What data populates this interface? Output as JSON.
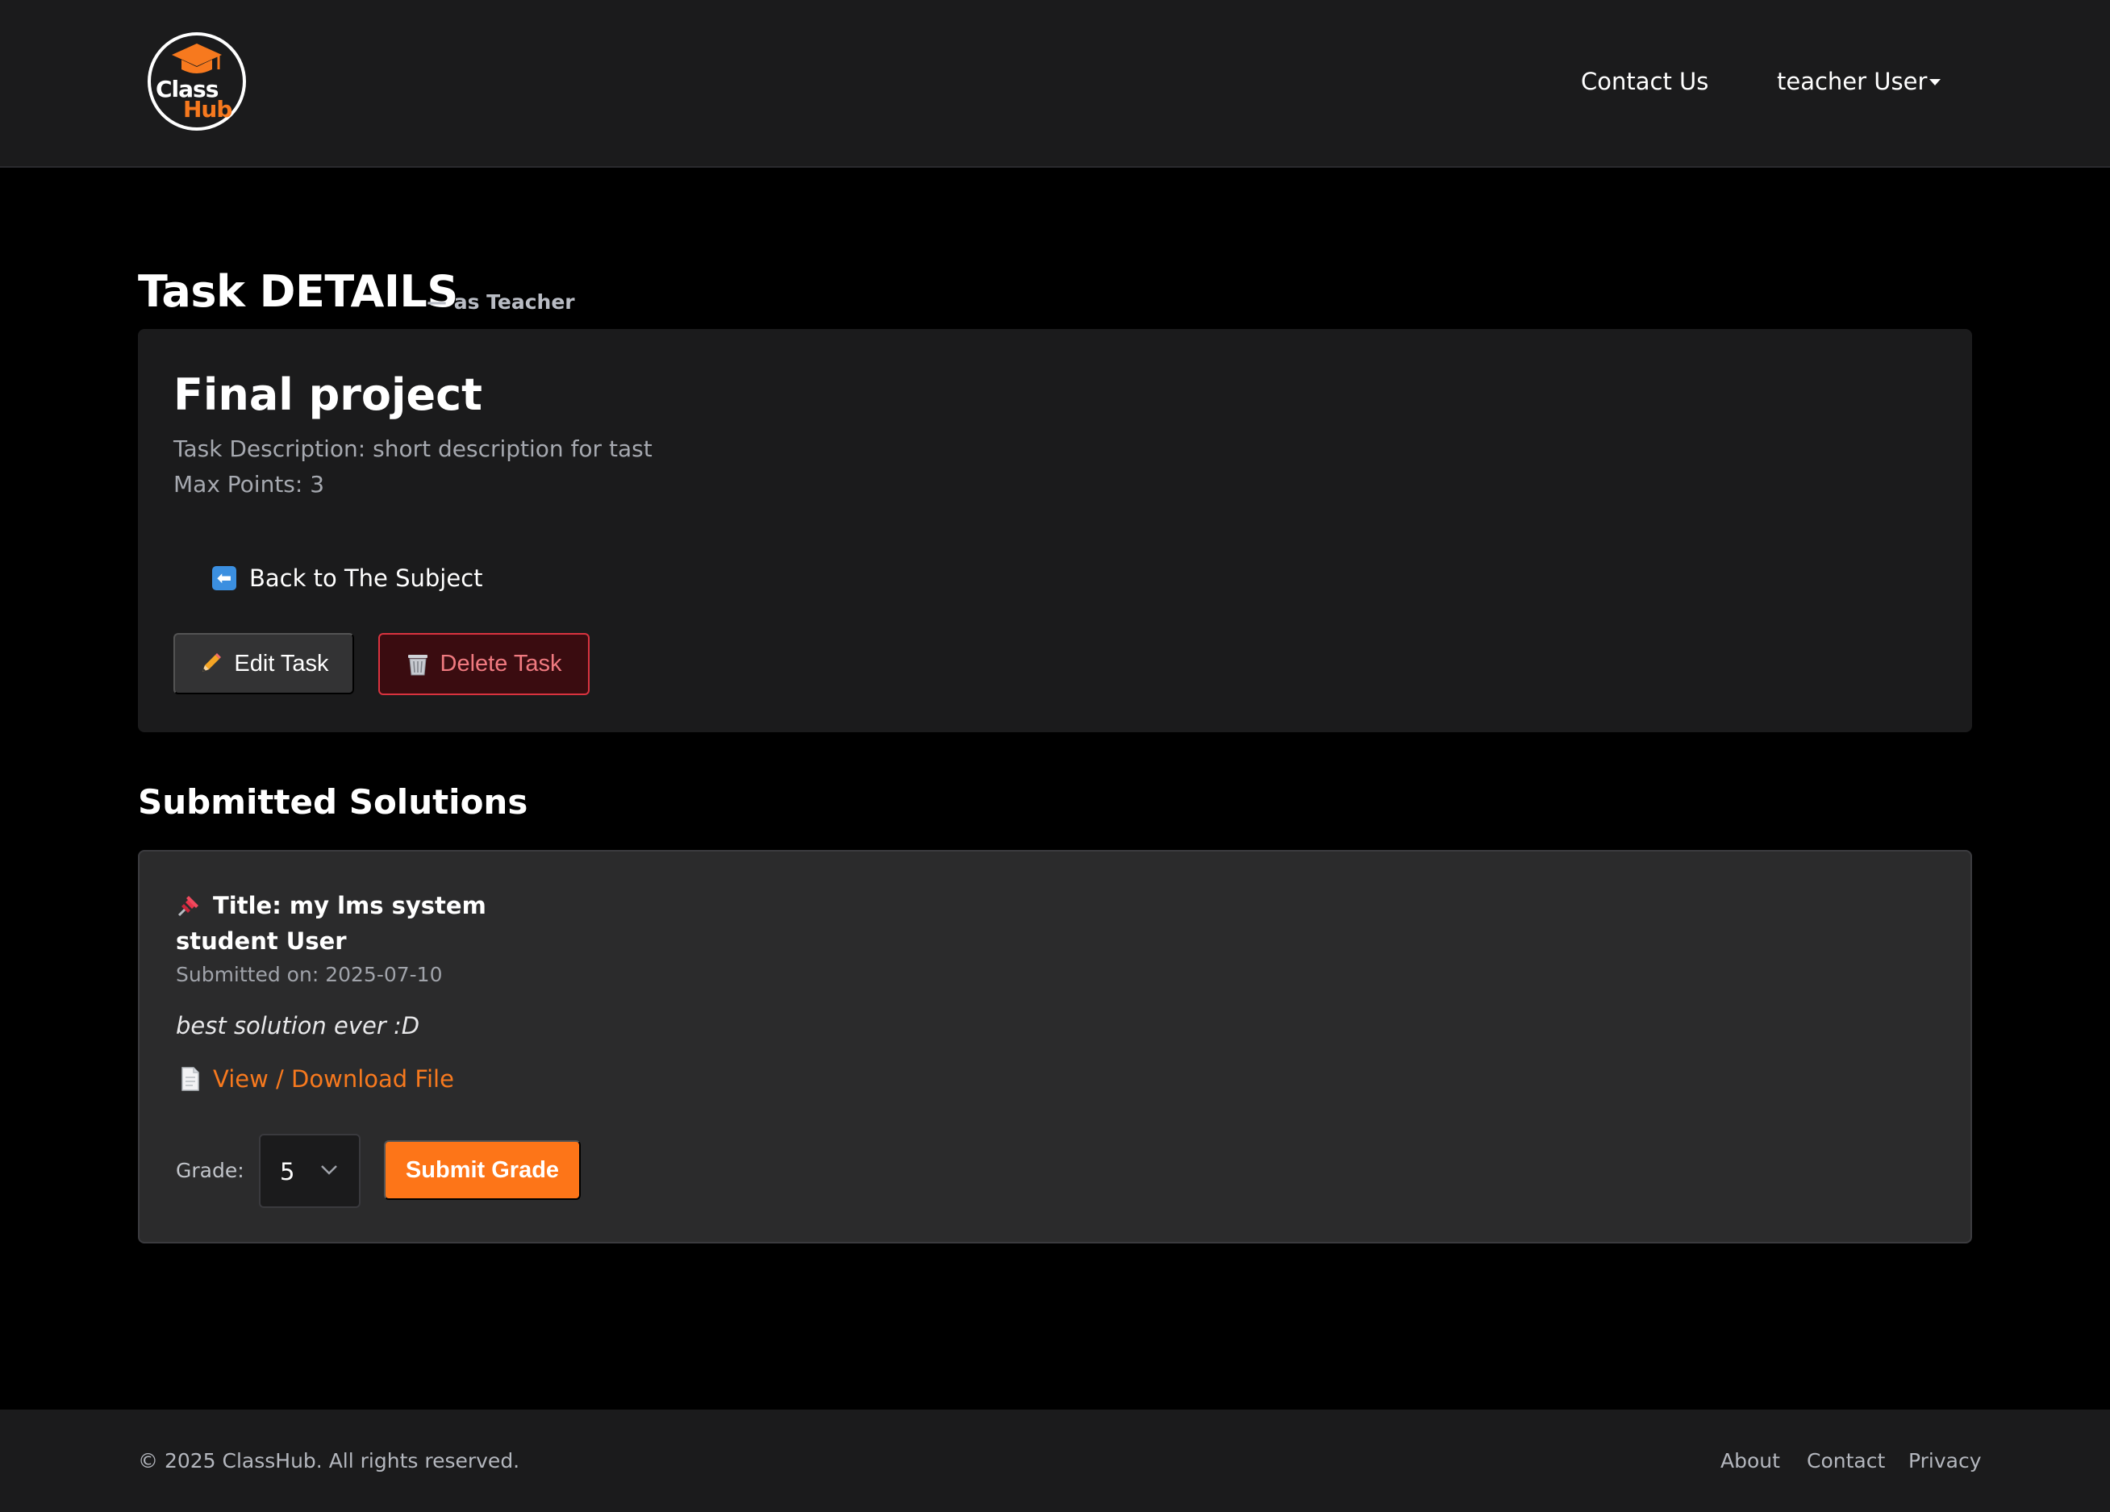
{
  "navbar": {
    "logo_text_1": "Class",
    "logo_text_2": "Hub",
    "contact_label": "Contact Us",
    "user_label": "teacher User"
  },
  "page": {
    "heading": "Task DETAILS",
    "heading_sub": "— as Teacher"
  },
  "task": {
    "title": "Final project",
    "description": "Task Description: short description for tast",
    "max_points": "Max Points: 3",
    "back_label": "Back to The Subject",
    "edit_label": "Edit Task",
    "delete_label": "Delete Task"
  },
  "submissions": {
    "section_title": "Submitted Solutions",
    "items": [
      {
        "title": "Title: my lms system",
        "student": "student User",
        "submitted_on": "Submitted on: 2025-07-10",
        "comment": "best solution ever :D",
        "file_label": "View / Download File",
        "grade_label": "Grade:",
        "grade_value": "5",
        "submit_label": "Submit Grade"
      }
    ]
  },
  "footer": {
    "copyright": "© 2025 ClassHub. All rights reserved.",
    "links": [
      "About",
      "Contact",
      "Privacy"
    ]
  },
  "colors": {
    "accent": "#fd7518",
    "danger": "#d9333f",
    "background": "#000000",
    "card": "#1b1b1c"
  }
}
